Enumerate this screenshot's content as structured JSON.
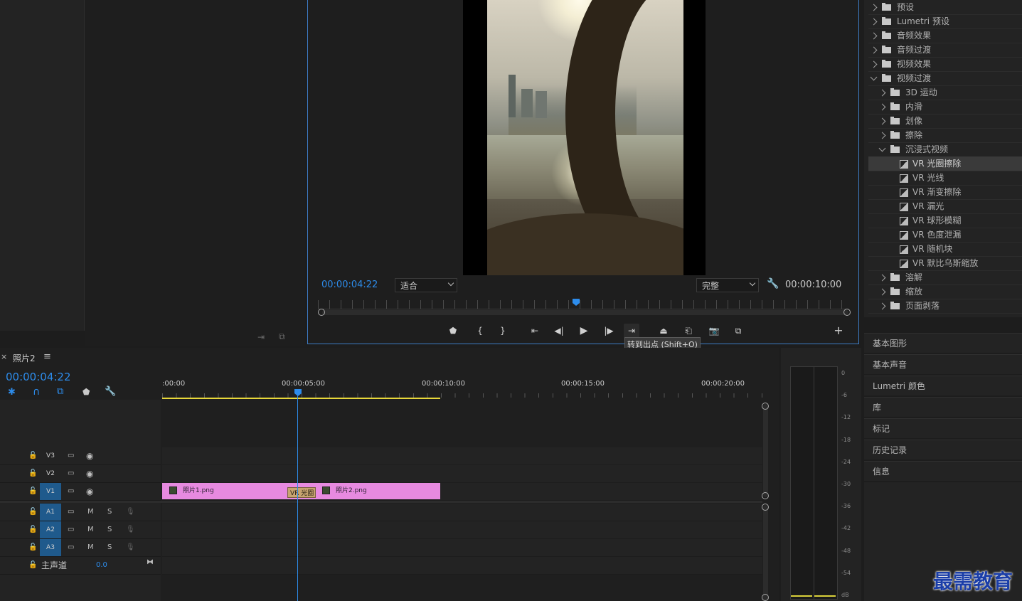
{
  "program_monitor": {
    "timecode": "00:00:04:22",
    "zoom_select": "适合",
    "quality_select": "完整",
    "duration": "00:00:10:00",
    "tooltip": "转到出点 (Shift+O)",
    "playhead_progress": 0.48
  },
  "effects_tree": {
    "items": [
      {
        "label": "预设",
        "level": 0,
        "kind": "preset",
        "expanded": false
      },
      {
        "label": "Lumetri 预设",
        "level": 0,
        "kind": "preset",
        "expanded": false
      },
      {
        "label": "音频效果",
        "level": 0,
        "kind": "folder",
        "expanded": false
      },
      {
        "label": "音频过渡",
        "level": 0,
        "kind": "folder",
        "expanded": false
      },
      {
        "label": "视频效果",
        "level": 0,
        "kind": "folder",
        "expanded": false
      },
      {
        "label": "视频过渡",
        "level": 0,
        "kind": "folder",
        "expanded": true
      },
      {
        "label": "3D 运动",
        "level": 1,
        "kind": "folder",
        "expanded": false
      },
      {
        "label": "内滑",
        "level": 1,
        "kind": "folder",
        "expanded": false
      },
      {
        "label": "划像",
        "level": 1,
        "kind": "folder",
        "expanded": false
      },
      {
        "label": "擦除",
        "level": 1,
        "kind": "folder",
        "expanded": false
      },
      {
        "label": "沉浸式视频",
        "level": 1,
        "kind": "folder",
        "expanded": true
      },
      {
        "label": "VR 光圈擦除",
        "level": 2,
        "kind": "effect",
        "selected": true
      },
      {
        "label": "VR 光线",
        "level": 2,
        "kind": "effect"
      },
      {
        "label": "VR 渐变擦除",
        "level": 2,
        "kind": "effect"
      },
      {
        "label": "VR 漏光",
        "level": 2,
        "kind": "effect"
      },
      {
        "label": "VR 球形模糊",
        "level": 2,
        "kind": "effect"
      },
      {
        "label": "VR 色度泄漏",
        "level": 2,
        "kind": "effect"
      },
      {
        "label": "VR 随机块",
        "level": 2,
        "kind": "effect"
      },
      {
        "label": "VR 默比乌斯缩放",
        "level": 2,
        "kind": "effect"
      },
      {
        "label": "溶解",
        "level": 1,
        "kind": "folder",
        "expanded": false
      },
      {
        "label": "缩放",
        "level": 1,
        "kind": "folder",
        "expanded": false
      },
      {
        "label": "页面剥落",
        "level": 1,
        "kind": "folder",
        "expanded": false
      }
    ]
  },
  "side_panels": [
    "基本图形",
    "基本声音",
    "Lumetri 颜色",
    "库",
    "标记",
    "历史记录",
    "信息"
  ],
  "timeline": {
    "close_glyph": "×",
    "sequence_name": "照片2",
    "menu_glyph": "≡",
    "timecode": "00:00:04:22",
    "ruler_labels": [
      ":00:00",
      "00:00:05:00",
      "00:00:10:00",
      "00:00:15:00",
      "00:00:20:00"
    ],
    "video_tracks": [
      "V3",
      "V2",
      "V1"
    ],
    "audio_tracks": [
      "A1",
      "A2",
      "A3"
    ],
    "audio_m_label": "M",
    "audio_s_label": "S",
    "master_track": {
      "label": "主声道",
      "value": "0.0"
    },
    "clips": [
      {
        "name": "照片1.png",
        "track": "V1"
      },
      {
        "name": "照片2.png",
        "track": "V1"
      }
    ],
    "transition_label": "VR 光圈"
  },
  "audio_meter": {
    "scale": [
      "0",
      "-6",
      "-12",
      "-18",
      "-24",
      "-30",
      "-36",
      "-42",
      "-48",
      "-54",
      "dB"
    ]
  },
  "watermark": "最需教育",
  "colors": {
    "accent_blue": "#2d8ceb",
    "clip_pink": "#e78ae0",
    "track_on": "#1f5a8c",
    "workarea_yellow": "#e8d83a"
  }
}
